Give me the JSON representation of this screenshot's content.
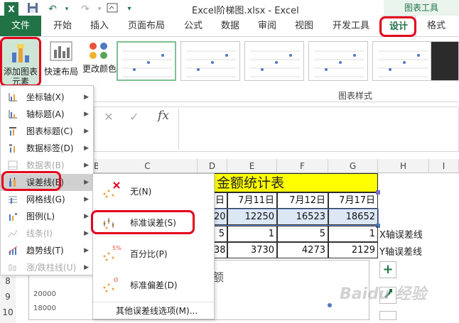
{
  "window": {
    "title": "Excel阶梯图.xlsx - Excel",
    "context_header": "图表工具"
  },
  "tabs": [
    {
      "label": "文件"
    },
    {
      "label": "开始"
    },
    {
      "label": "插入"
    },
    {
      "label": "页面布局"
    },
    {
      "label": "公式"
    },
    {
      "label": "数据"
    },
    {
      "label": "审阅"
    },
    {
      "label": "视图"
    },
    {
      "label": "开发工具"
    },
    {
      "label": "设计"
    },
    {
      "label": "格式"
    }
  ],
  "ribbon": {
    "add_chart_element": "添加图表元素",
    "quick_layout": "快速布局",
    "change_colors": "更改颜色",
    "chart_styles_group": "图表样式"
  },
  "formula_bar": {
    "fx": "fx",
    "cancel": "✕",
    "confirm": "✓"
  },
  "menu": {
    "items": [
      {
        "label": "坐标轴(X)",
        "disabled": false
      },
      {
        "label": "轴标题(A)",
        "disabled": false
      },
      {
        "label": "图表标题(C)",
        "disabled": false
      },
      {
        "label": "数据标签(D)",
        "disabled": false
      },
      {
        "label": "数据表(B)",
        "disabled": true
      },
      {
        "label": "误差线(E)",
        "disabled": false
      },
      {
        "label": "网格线(G)",
        "disabled": false
      },
      {
        "label": "图例(L)",
        "disabled": false
      },
      {
        "label": "线条(I)",
        "disabled": true
      },
      {
        "label": "趋势线(T)",
        "disabled": false
      },
      {
        "label": "涨/跌柱线(U)",
        "disabled": true
      }
    ]
  },
  "submenu": {
    "items": [
      {
        "label": "无(N)"
      },
      {
        "label": "标准误差(S)"
      },
      {
        "label": "百分比(P)"
      },
      {
        "label": "标准偏差(D)"
      }
    ],
    "more": "其他误差线选项(M)...",
    "percent_badge": "5%",
    "sigma_badge": "σ"
  },
  "grid": {
    "col_headers": [
      "B",
      "C",
      "D",
      "E",
      "F",
      "G",
      "H",
      "I"
    ],
    "row_numbers": [
      "8",
      "9",
      "10"
    ],
    "title": "金额统计表",
    "dates": [
      "日",
      "7月11日",
      "7月12日",
      "7月17日"
    ],
    "row1": [
      "20",
      "12250",
      "16523",
      "18652"
    ],
    "row2": [
      "5",
      "1",
      "5",
      "1"
    ],
    "row2_label": "X轴误差线",
    "row3": [
      "38",
      "3730",
      "4273",
      "2129"
    ],
    "row3_label": "Y轴误差线",
    "chart_title_fragment": "额",
    "axis_ticks": [
      "20000",
      "18000"
    ]
  },
  "watermark": "Baidu 经验"
}
